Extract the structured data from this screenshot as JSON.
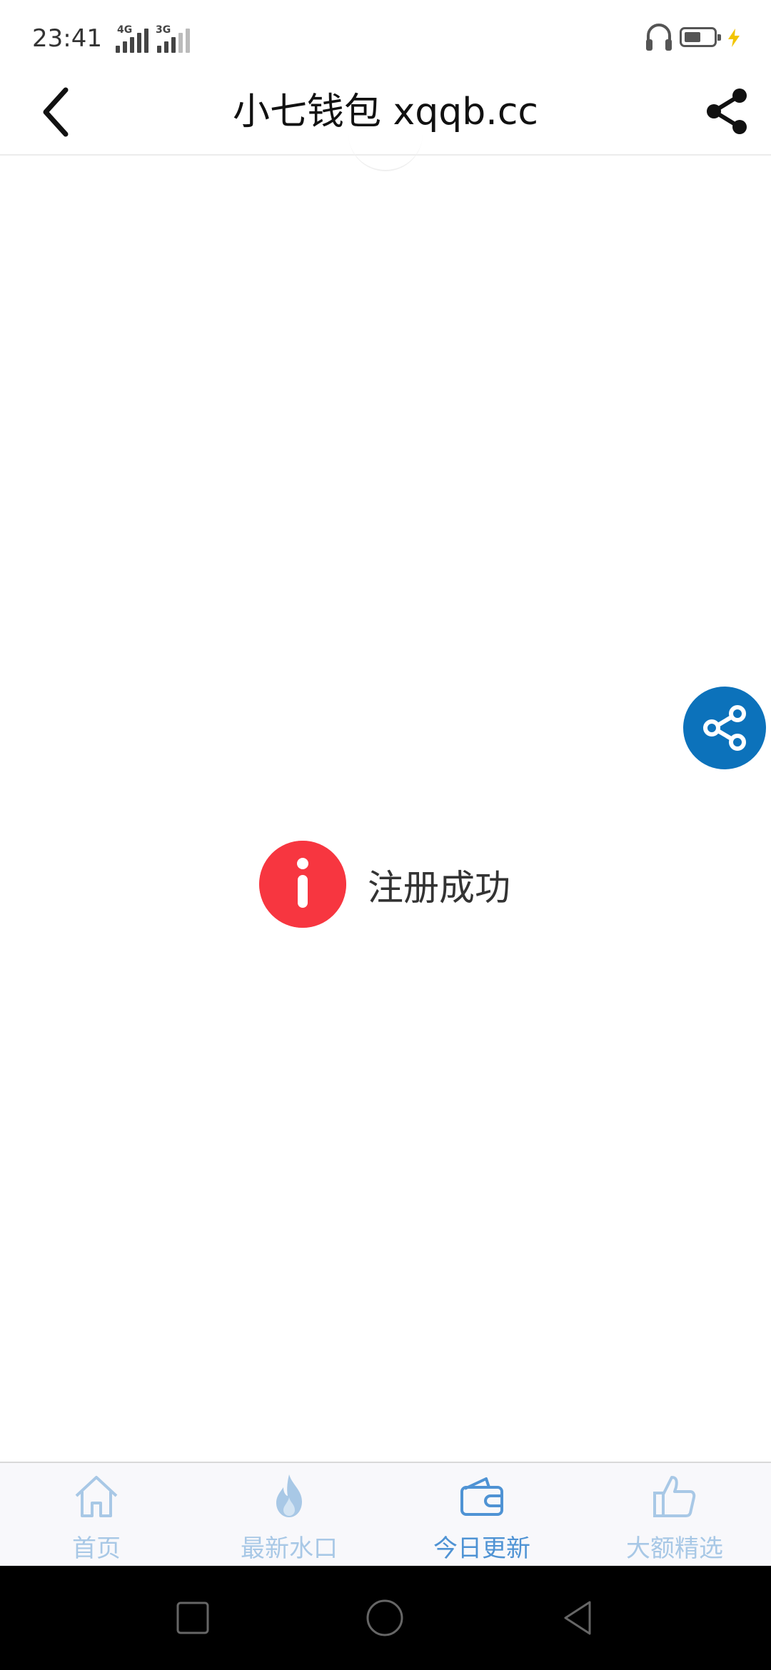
{
  "status_bar": {
    "time": "23:41",
    "network_1": "4G",
    "network_2": "3G",
    "icons": [
      "headphone-icon",
      "battery-icon",
      "charging-icon"
    ]
  },
  "title_bar": {
    "title": "小七钱包 xqqb.cc",
    "back_icon": "back-arrow-icon",
    "share_icon": "share-icon"
  },
  "toast": {
    "icon": "info-icon",
    "text": "注册成功",
    "color": "#f73640"
  },
  "floating_share": {
    "icon": "share-icon",
    "color": "#0c72bb"
  },
  "tabs": [
    {
      "label": "首页",
      "icon": "home-icon",
      "active": false
    },
    {
      "label": "最新水口",
      "icon": "fire-icon",
      "active": false
    },
    {
      "label": "今日更新",
      "icon": "wallet-icon",
      "active": true
    },
    {
      "label": "大额精选",
      "icon": "thumbs-up-icon",
      "active": false
    }
  ],
  "colors": {
    "tab_inactive": "#a8c8e6",
    "tab_active": "#4f93d4"
  },
  "system_nav": [
    "recents-icon",
    "home-circle-icon",
    "back-triangle-icon"
  ]
}
